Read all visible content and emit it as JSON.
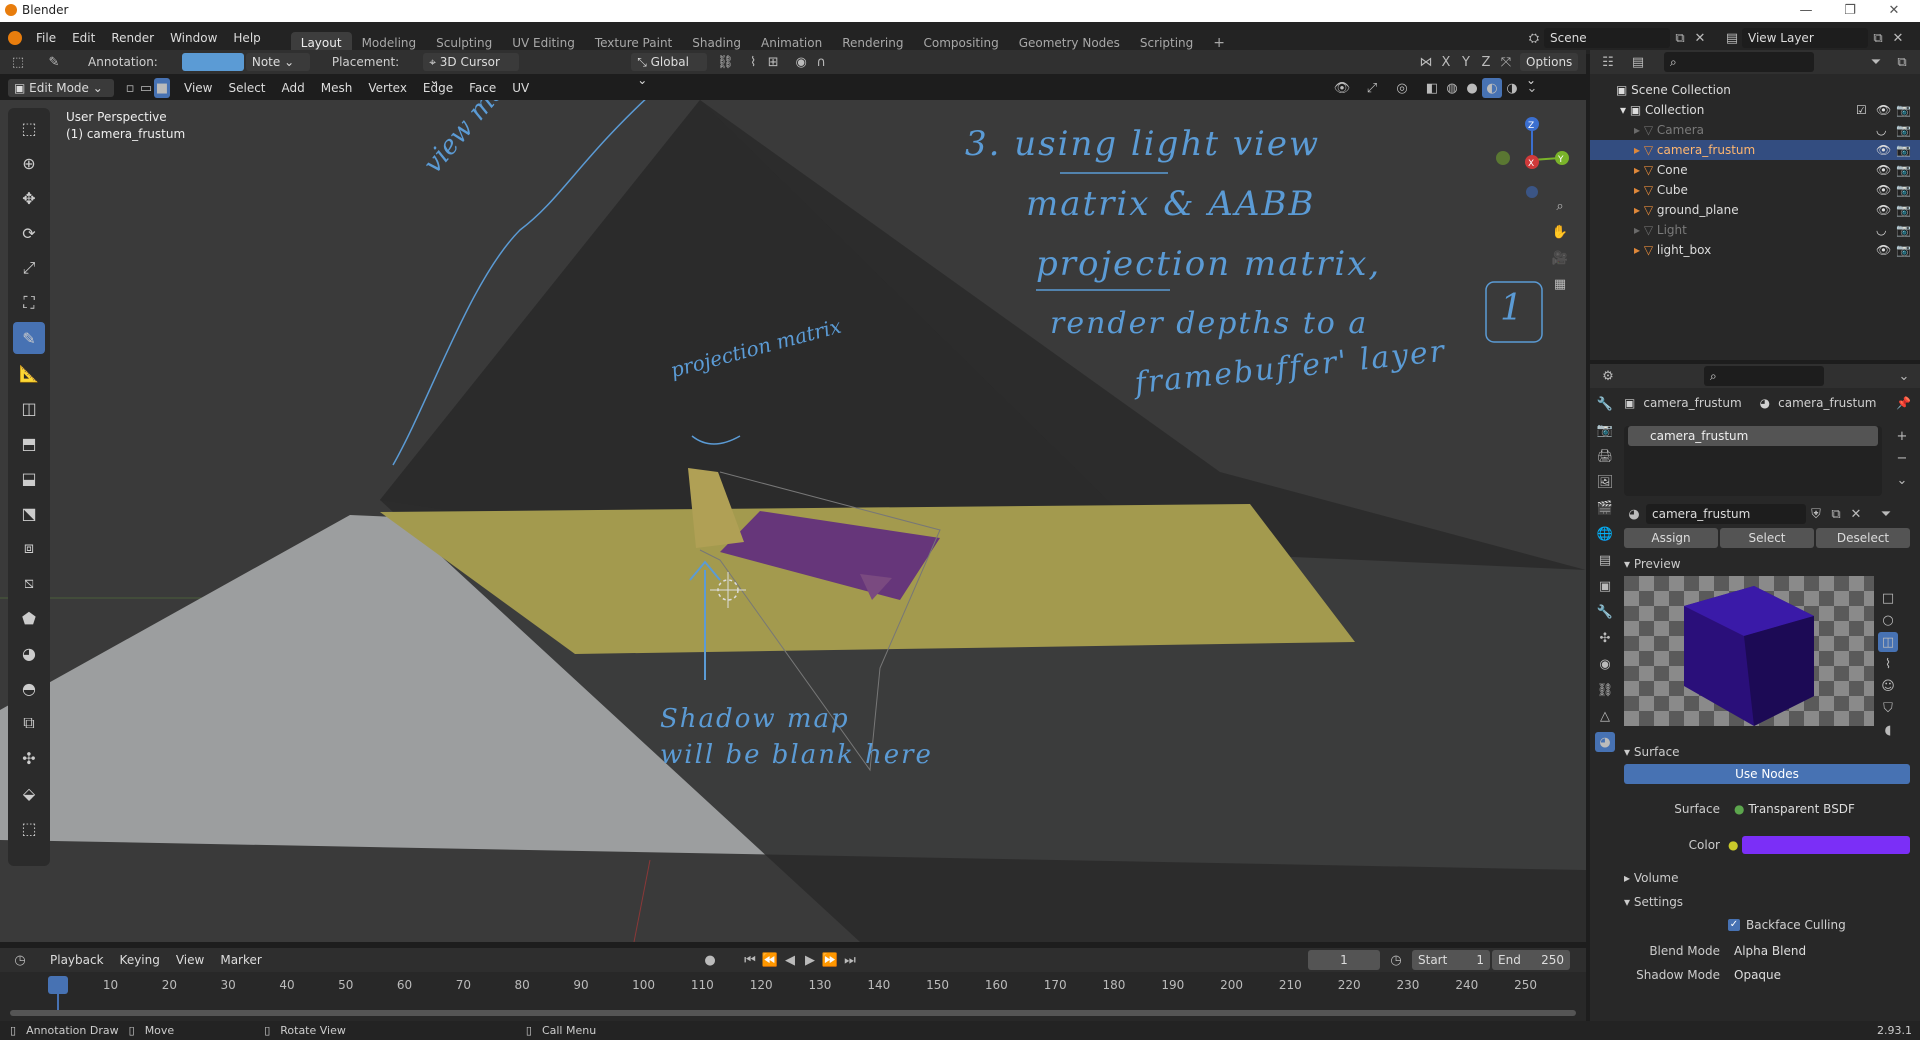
{
  "window": {
    "title": "Blender",
    "version": "2.93.1"
  },
  "menu": [
    "File",
    "Edit",
    "Render",
    "Window",
    "Help"
  ],
  "workspaces": [
    "Layout",
    "Modeling",
    "Sculpting",
    "UV Editing",
    "Texture Paint",
    "Shading",
    "Animation",
    "Rendering",
    "Compositing",
    "Geometry Nodes",
    "Scripting"
  ],
  "active_workspace": "Layout",
  "scene": {
    "name": "Scene",
    "view_layer": "View Layer"
  },
  "tool_header": {
    "annotation_label": "Annotation:",
    "note": "Note",
    "placement_label": "Placement:",
    "placement": "3D Cursor",
    "transform": "Global",
    "options": "Options"
  },
  "viewport_header": {
    "mode": "Edit Mode",
    "menus": [
      "View",
      "Select",
      "Add",
      "Mesh",
      "Vertex",
      "Edge",
      "Face",
      "UV"
    ]
  },
  "viewport": {
    "perspective": "User Perspective",
    "object": "(1) camera_frustum",
    "annotations": {
      "view_matrix": "view matrix",
      "projection_matrix": "projection matrix",
      "note3_line1": "3. using light view",
      "note3_line2": "matrix & AABB",
      "note3_line3": "projection matrix,",
      "note3_line4": "render depths to a",
      "note3_line5": "framebuffer' layer",
      "note3_box": "1",
      "shadow_line1": "Shadow map",
      "shadow_line2": "will be blank here"
    }
  },
  "outliner": {
    "root": "Scene Collection",
    "collection": "Collection",
    "items": [
      {
        "name": "Camera",
        "dim": true,
        "selected": false
      },
      {
        "name": "camera_frustum",
        "dim": false,
        "selected": true
      },
      {
        "name": "Cone",
        "dim": false,
        "selected": false
      },
      {
        "name": "Cube",
        "dim": false,
        "selected": false
      },
      {
        "name": "ground_plane",
        "dim": false,
        "selected": false
      },
      {
        "name": "Light",
        "dim": true,
        "selected": false
      },
      {
        "name": "light_box",
        "dim": false,
        "selected": false
      }
    ]
  },
  "properties": {
    "breadcrumb_object": "camera_frustum",
    "breadcrumb_material": "camera_frustum",
    "slot": "camera_frustum",
    "material_name": "camera_frustum",
    "assign": "Assign",
    "select": "Select",
    "deselect": "Deselect",
    "preview": "Preview",
    "surface_section": "Surface",
    "use_nodes": "Use Nodes",
    "surface_label": "Surface",
    "surface_value": "Transparent BSDF",
    "color_label": "Color",
    "color_value": "#7b2ff7",
    "volume": "Volume",
    "settings": "Settings",
    "backface_culling": "Backface Culling",
    "blend_mode_label": "Blend Mode",
    "blend_mode": "Alpha Blend",
    "shadow_mode_label": "Shadow Mode",
    "shadow_mode": "Opaque"
  },
  "timeline": {
    "menus": [
      "Playback",
      "Keying",
      "View",
      "Marker"
    ],
    "current_frame": "1",
    "start_label": "Start",
    "start": "1",
    "end_label": "End",
    "end": "250",
    "ticks": [
      "1",
      "10",
      "20",
      "30",
      "40",
      "50",
      "60",
      "70",
      "80",
      "90",
      "100",
      "110",
      "120",
      "130",
      "140",
      "150",
      "160",
      "170",
      "180",
      "190",
      "200",
      "210",
      "220",
      "230",
      "240",
      "250"
    ]
  },
  "statusbar": {
    "annotation_draw": "Annotation Draw",
    "move": "Move",
    "rotate_view": "Rotate View",
    "call_menu": "Call Menu"
  },
  "colors": {
    "accent": "#4772b3",
    "annotation": "#5b9bd5",
    "ground": "#9c9e9f",
    "plane_yellow": "#a39a4e",
    "material": "#7b2ff7"
  }
}
